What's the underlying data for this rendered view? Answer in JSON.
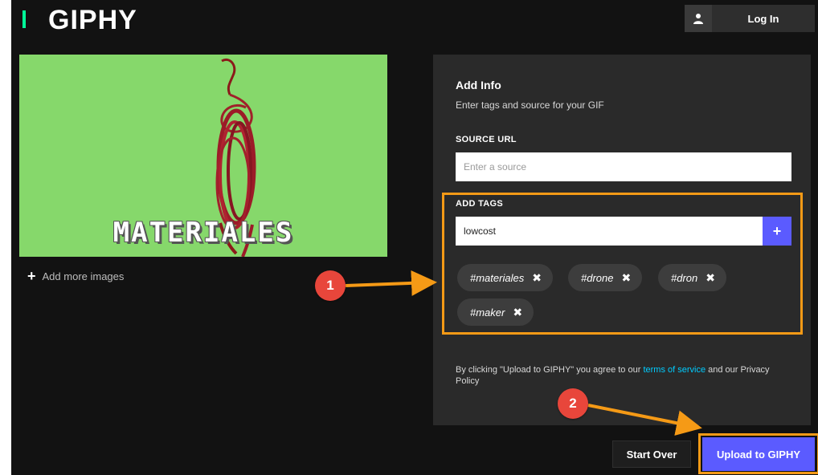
{
  "header": {
    "logo": "GIPHY",
    "login_label": "Log In",
    "user_icon": "user-icon"
  },
  "preview": {
    "overlay_text": "MATERIALES",
    "add_more_label": "Add more images"
  },
  "info_panel": {
    "title": "Add Info",
    "subtitle": "Enter tags and source for your GIF",
    "source_label": "SOURCE URL",
    "source_placeholder": "Enter a source",
    "tags_label": "ADD TAGS",
    "tag_input_value": "lowcost",
    "add_tag_button": "+",
    "tags": [
      {
        "label": "#materiales",
        "remove": "✖"
      },
      {
        "label": "#drone",
        "remove": "✖"
      },
      {
        "label": "#dron",
        "remove": "✖"
      },
      {
        "label": "#maker",
        "remove": "✖"
      }
    ],
    "legal_prefix": "By clicking \"Upload to GIPHY\" you agree to our ",
    "legal_link": "terms of service",
    "legal_suffix": " and our Privacy Policy"
  },
  "footer": {
    "start_over_label": "Start Over",
    "upload_label": "Upload to GIPHY"
  },
  "annotations": {
    "step1": "1",
    "step2": "2"
  },
  "colors": {
    "accent": "#5b5bff",
    "annotation_orange": "#f59a16",
    "badge_red": "#e8463b",
    "link": "#00ccff",
    "logo_bar": "#00ff99"
  }
}
